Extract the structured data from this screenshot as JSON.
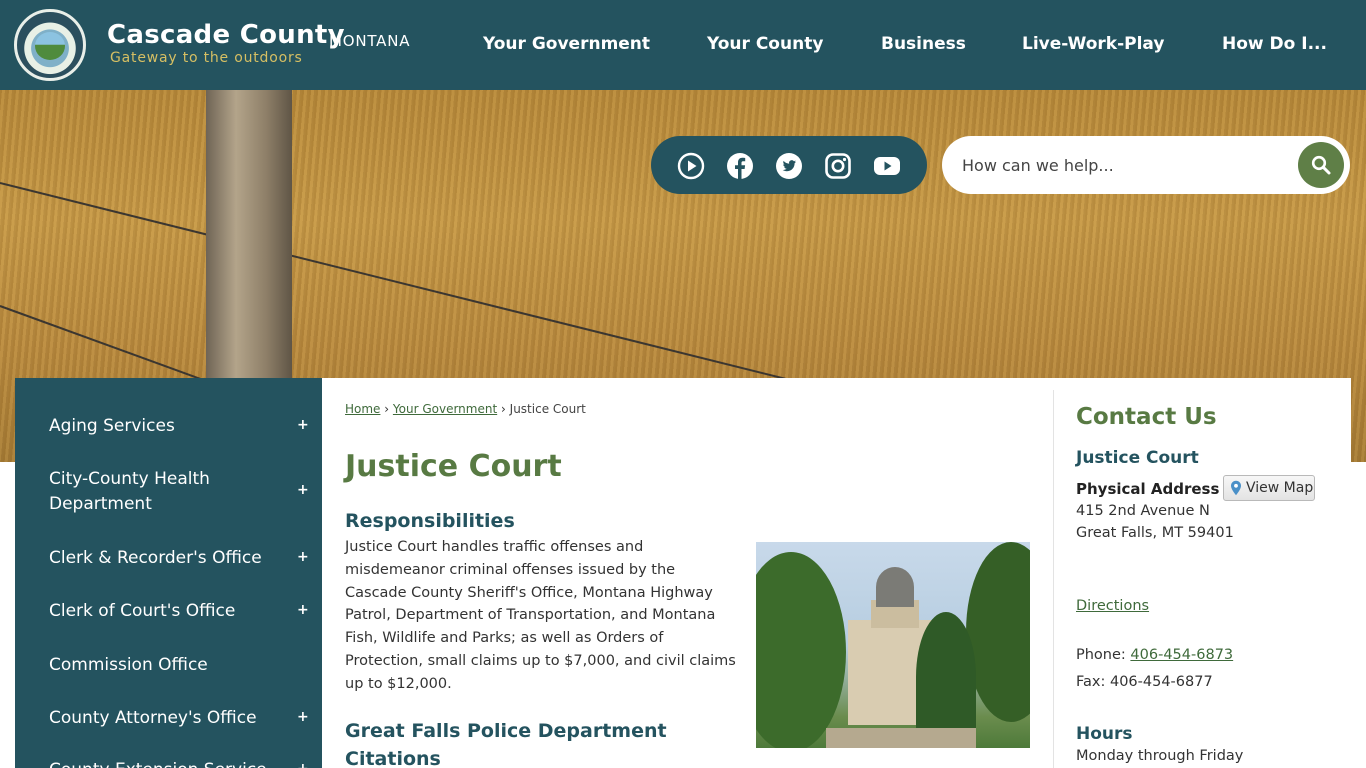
{
  "header": {
    "site_name": "Cascade County",
    "state": "MONTANA",
    "tagline": "Gateway to the outdoors",
    "nav": [
      "Your Government",
      "Your County",
      "Business",
      "Live-Work-Play",
      "How Do I..."
    ]
  },
  "social": {
    "icons": [
      "play-icon",
      "facebook-icon",
      "twitter-icon",
      "instagram-icon",
      "youtube-icon"
    ]
  },
  "search": {
    "placeholder": "How can we help..."
  },
  "sidebar": {
    "items": [
      {
        "label": "Aging Services",
        "expand": "+"
      },
      {
        "label": "City-County Health Department",
        "expand": "+"
      },
      {
        "label": "Clerk & Recorder's Office",
        "expand": "+"
      },
      {
        "label": "Clerk of Court's Office",
        "expand": "+"
      },
      {
        "label": "Commission Office",
        "expand": ""
      },
      {
        "label": "County Attorney's Office",
        "expand": "+"
      },
      {
        "label": "County Extension Service",
        "expand": "+"
      }
    ]
  },
  "breadcrumb": {
    "home": "Home",
    "sep": "›",
    "parent": "Your Government",
    "current": "Justice Court"
  },
  "main": {
    "title": "Justice Court",
    "section1_heading": "Responsibilities",
    "section1_text": "Justice Court handles traffic offenses and misdemeanor criminal offenses issued by the Cascade County Sheriff's Office, Montana Highway Patrol, Department of Transportation, and Montana Fish, Wildlife and Parks; as well as Orders of Protection, small claims up to $7,000, and civil claims up to $12,000.",
    "section2_heading_line1": "Great Falls Police Department",
    "section2_heading_line2": "Citations"
  },
  "contact": {
    "title": "Contact Us",
    "department": "Justice Court",
    "address_label": "Physical Address",
    "map_button": "View Map",
    "address_line1": "415 2nd Avenue N",
    "address_line2": "Great Falls, MT 59401",
    "directions": "Directions",
    "phone_label": "Phone:",
    "phone": "406-454-6873",
    "fax": "Fax: 406-454-6877",
    "hours_title": "Hours",
    "hours_line1": "Monday through Friday"
  },
  "colors": {
    "primary": "#24535f",
    "accent_green": "#587a43",
    "tagline_gold": "#d6bf63"
  }
}
